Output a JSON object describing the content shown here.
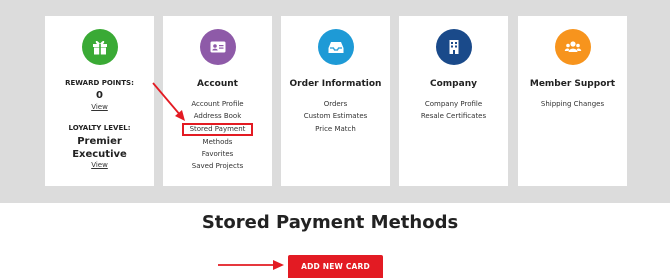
{
  "colors": {
    "reward_icon": "#3aaa35",
    "account_icon": "#8e5aa8",
    "order_icon": "#1e9ad6",
    "company_icon": "#1a4a8a",
    "support_icon": "#f7941d",
    "highlight": "#e31b23",
    "button": "#e31b23"
  },
  "cards": {
    "reward": {
      "icon": "gift-icon",
      "points_label": "REWARD POINTS:",
      "points_value": "0",
      "points_view": "View",
      "loyalty_label": "LOYALTY LEVEL:",
      "loyalty_line1": "Premier",
      "loyalty_line2": "Executive",
      "loyalty_view": "View"
    },
    "account": {
      "icon": "id-card-icon",
      "title": "Account",
      "links": [
        "Account Profile",
        "Address Book",
        "Stored Payment",
        "Methods",
        "Favorites",
        "Saved Projects"
      ]
    },
    "order": {
      "icon": "inbox-icon",
      "title": "Order Information",
      "links": [
        "Orders",
        "Custom Estimates",
        "Price Match"
      ]
    },
    "company": {
      "icon": "building-icon",
      "title": "Company",
      "links": [
        "Company Profile",
        "Resale Certificates"
      ]
    },
    "support": {
      "icon": "users-icon",
      "title": "Member Support",
      "links": [
        "Shipping Changes"
      ]
    }
  },
  "page": {
    "heading": "Stored Payment Methods",
    "add_button": "ADD NEW CARD"
  }
}
